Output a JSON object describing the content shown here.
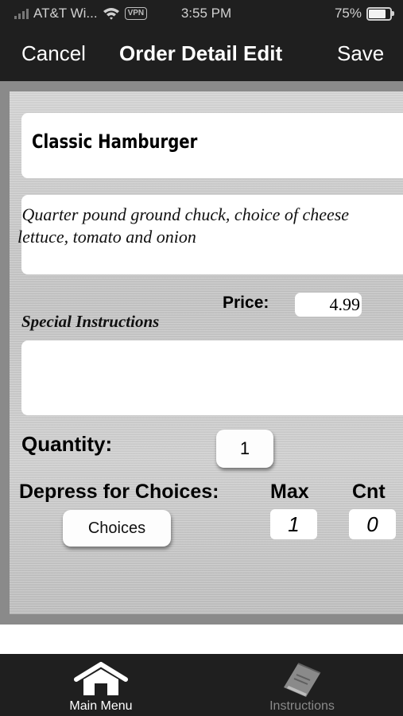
{
  "status_bar": {
    "carrier": "AT&T Wi...",
    "vpn": "VPN",
    "time": "3:55 PM",
    "battery": "75%",
    "battery_level": 0.75
  },
  "nav": {
    "cancel_label": "Cancel",
    "title": "Order Detail Edit",
    "save_label": "Save"
  },
  "item": {
    "name": "Classic Hamburger",
    "description": " Quarter pound ground chuck, choice of cheese\nlettuce, tomato and onion",
    "price_label": "Price:",
    "price": "4.99",
    "special_instructions_label": "Special Instructions",
    "special_instructions": ""
  },
  "quantity": {
    "label": "Quantity:",
    "value": "1"
  },
  "choices": {
    "label": "Depress for Choices:",
    "button_label": "Choices",
    "max_label": "Max",
    "max_value": "1",
    "cnt_label": "Cnt",
    "cnt_value": "0"
  },
  "tab_bar": {
    "tabs": [
      {
        "label": "Main Menu",
        "icon": "home-icon",
        "active": true
      },
      {
        "label": "Instructions",
        "icon": "book-icon",
        "active": false
      }
    ]
  },
  "colors": {
    "bar_background": "#1f1f1f",
    "active_tab": "#ffffff",
    "inactive_tab": "#8a8a8a"
  }
}
